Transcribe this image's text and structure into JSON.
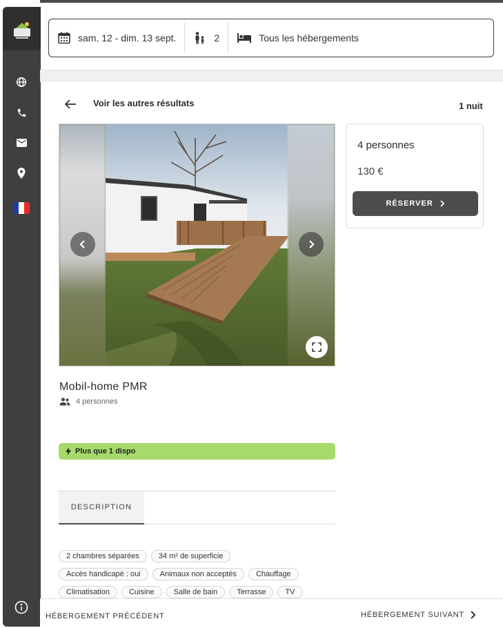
{
  "search": {
    "dates": "sam. 12 - dim. 13 sept.",
    "guests": "2",
    "accommodation_type": "Tous les hébergements"
  },
  "header": {
    "back_label": "Voir les autres résultats",
    "nights": "1 nuit"
  },
  "listing": {
    "title": "Mobil-home PMR",
    "capacity": "4 personnes",
    "availability": "Plus que 1 dispo"
  },
  "booking": {
    "persons": "4 personnes",
    "price": "130 €",
    "reserve_label": "RÉSERVER"
  },
  "tabs": [
    {
      "label": "DESCRIPTION",
      "active": true
    }
  ],
  "amenities": [
    [
      "2 chambres séparées",
      "34 m² de superficie"
    ],
    [
      "Accès handicapé : oui",
      "Animaux non acceptés",
      "Chauffage"
    ],
    [
      "Climatisation",
      "Cuisine",
      "Salle de bain",
      "Terrasse",
      "TV"
    ]
  ],
  "footer": {
    "previous_label": "HÉBERGEMENT PRÉCÉDENT",
    "next_label": "HÉBERGEMENT SUIVANT"
  },
  "sidebar": {
    "icons": [
      "globe-icon",
      "phone-icon",
      "mail-icon",
      "location-pin-icon",
      "french-flag-icon"
    ],
    "bottom_icon": "info-icon"
  },
  "colors": {
    "sidebar": "#3f3f3f",
    "reserve_button": "#4e4c4d",
    "availability_badge": "#a6db6b",
    "flag_blue": "#1f3fa8",
    "flag_white": "#ffffff",
    "flag_red": "#e52b2b"
  }
}
